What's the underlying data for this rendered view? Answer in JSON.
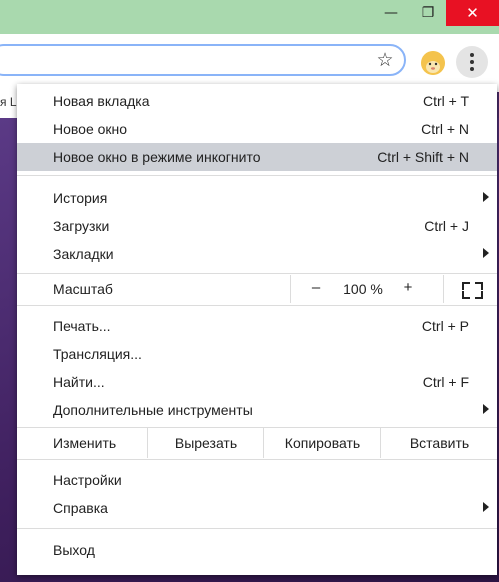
{
  "window_controls": {
    "minimize": "—",
    "maximize": "❐",
    "close": "✕"
  },
  "toolbar": {
    "bookmark_icon": "star-icon",
    "profile_icon": "avatar",
    "menu_icon": "kebab-menu-icon"
  },
  "bookmarks_bar": {
    "partial_text": "я L"
  },
  "menu": {
    "new_tab": {
      "label": "Новая вкладка",
      "shortcut": "Ctrl + T"
    },
    "new_window": {
      "label": "Новое окно",
      "shortcut": "Ctrl + N"
    },
    "incognito": {
      "label": "Новое окно в режиме инкогнито",
      "shortcut": "Ctrl + Shift + N"
    },
    "history": {
      "label": "История"
    },
    "downloads": {
      "label": "Загрузки",
      "shortcut": "Ctrl + J"
    },
    "bookmarks": {
      "label": "Закладки"
    },
    "zoom": {
      "label": "Масштаб",
      "minus": "–",
      "value": "100 %",
      "plus": "+"
    },
    "print": {
      "label": "Печать...",
      "shortcut": "Ctrl + P"
    },
    "cast": {
      "label": "Трансляция..."
    },
    "find": {
      "label": "Найти...",
      "shortcut": "Ctrl + F"
    },
    "more_tools": {
      "label": "Дополнительные инструменты"
    },
    "edit": {
      "label": "Изменить",
      "cut": "Вырезать",
      "copy": "Копировать",
      "paste": "Вставить"
    },
    "settings": {
      "label": "Настройки"
    },
    "help": {
      "label": "Справка"
    },
    "exit": {
      "label": "Выход"
    }
  }
}
